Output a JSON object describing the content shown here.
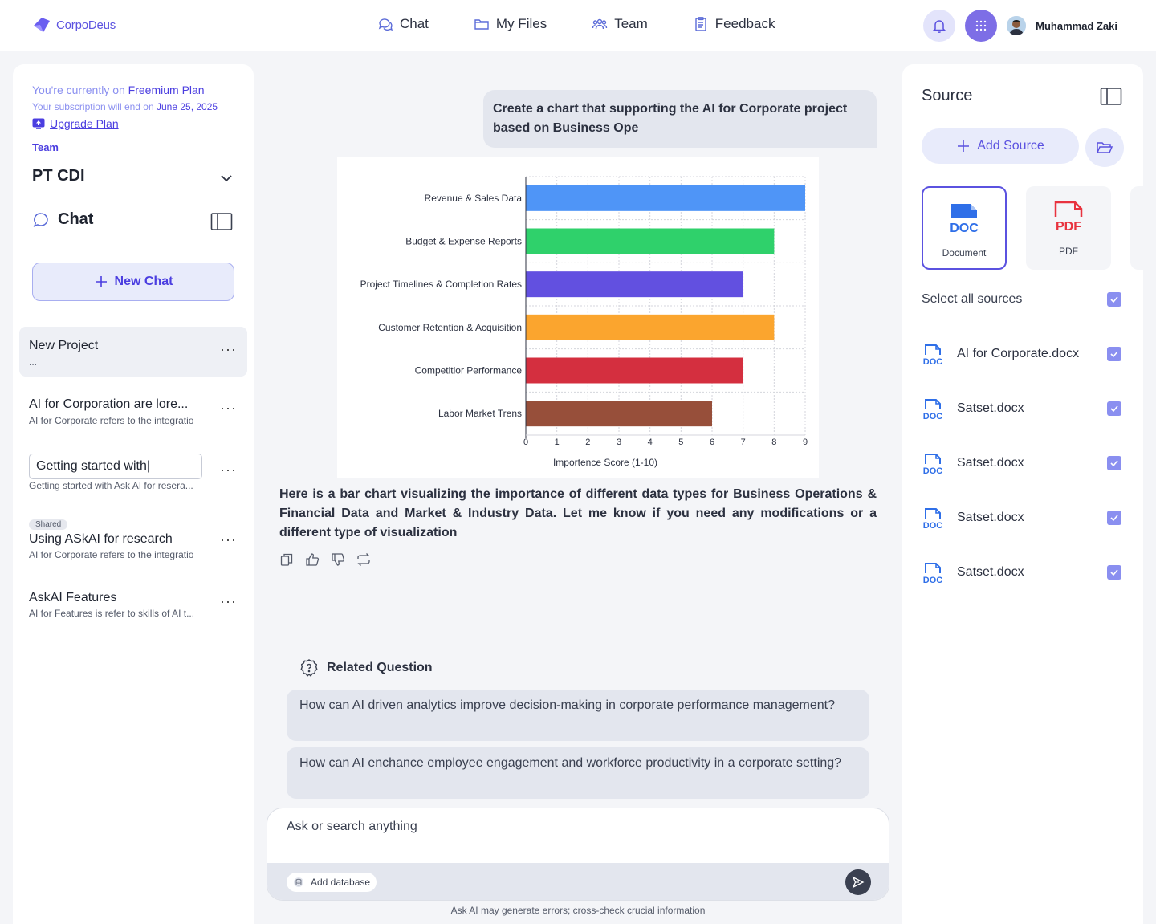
{
  "header": {
    "logo_text": "CorpoDeus",
    "nav": [
      {
        "label": "Chat",
        "icon": "chat-icon"
      },
      {
        "label": "My Files",
        "icon": "folder-icon"
      },
      {
        "label": "Team",
        "icon": "team-icon"
      },
      {
        "label": "Feedback",
        "icon": "clipboard-icon"
      }
    ],
    "username": "Muhammad Zaki"
  },
  "sidebar": {
    "plan_prefix": "You're currently on ",
    "plan_name": "Freemium Plan",
    "sub_prefix": "Your subscription will end on ",
    "sub_date": "June 25, 2025",
    "upgrade_label": "Upgrade Plan",
    "team_label": "Team",
    "team_name": "PT CDI",
    "chat_title": "Chat",
    "new_chat_label": "New Chat",
    "chats": [
      {
        "title": "New Project",
        "subtitle": "...",
        "active": true
      },
      {
        "title": "AI for Corporation are lore...",
        "subtitle": "AI for Corporate refers to the integratio"
      },
      {
        "title": "Getting started with|",
        "subtitle": "Getting started with Ask AI for resera...",
        "editing": true
      },
      {
        "title": "Using ASkAI for research",
        "subtitle": "AI for Corporate refers to the integratio",
        "tag": "Shared"
      },
      {
        "title": "AskAI Features",
        "subtitle": "AI for Features is refer to skills of AI t..."
      }
    ]
  },
  "main": {
    "user_message": "Create a chart that supporting the AI for Corporate project based on Business Ope",
    "answer": "Here is a bar chart visualizing the importance of different data types for Business Operations & Financial Data and Market & Industry Data. Let me know if you need any modifications or a different type of visualization",
    "related_title": "Related Question",
    "related_questions": [
      "How can AI driven analytics improve decision-making in corporate performance management?",
      "How can AI enchance employee engagement and workforce productivity in a corporate setting?"
    ],
    "input_placeholder": "Ask or search anything",
    "add_database_label": "Add database",
    "disclaimer": "Ask AI may generate errors; cross-check crucial information"
  },
  "chart_data": {
    "type": "bar",
    "orientation": "horizontal",
    "categories": [
      "Revenue & Sales Data",
      "Budget & Expense Reports",
      "Project Timelines & Completion Rates",
      "Customer Retention & Acquisition",
      "Competitior Performance",
      "Labor Market Trens"
    ],
    "values": [
      9,
      8,
      7,
      8,
      7,
      6
    ],
    "colors": [
      "#4f95f7",
      "#2fd16b",
      "#6250e0",
      "#fba52e",
      "#d42f3f",
      "#974f3a"
    ],
    "xlabel": "Importence Score (1-10)",
    "ylabel": "",
    "xlim": [
      0,
      9
    ],
    "xticks": [
      "0",
      "1",
      "2",
      "3",
      "4",
      "5",
      "6",
      "7",
      "8",
      "9"
    ],
    "grid": true
  },
  "source_panel": {
    "title": "Source",
    "add_source_label": "Add Source",
    "types": [
      {
        "badge": "DOC",
        "label": "Document",
        "selected": true,
        "color": "#2f6fe8"
      },
      {
        "badge": "PDF",
        "label": "PDF",
        "selected": false,
        "color": "#e8333f"
      }
    ],
    "select_all_label": "Select all sources",
    "files": [
      {
        "name": "AI for Corporate.docx",
        "checked": true
      },
      {
        "name": "Satset.docx",
        "checked": true
      },
      {
        "name": "Satset.docx",
        "checked": true
      },
      {
        "name": "Satset.docx",
        "checked": true
      },
      {
        "name": "Satset.docx",
        "checked": true
      }
    ],
    "doc_badge": "DOC"
  }
}
